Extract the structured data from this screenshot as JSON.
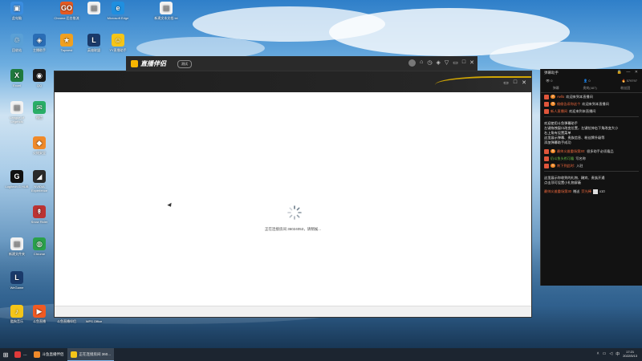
{
  "desktop": {
    "icons": [
      {
        "label": "此电脑",
        "color": "#3a8de0",
        "glyph": "▣"
      },
      {
        "label": "Chrome 后台推流",
        "color": "#e45a23",
        "glyph": "GO"
      },
      {
        "label": "",
        "color": "#f2f2f2",
        "glyph": "▤"
      },
      {
        "label": "Microsoft Edge",
        "color": "#1f8fe0",
        "glyph": "e"
      },
      {
        "label": "新建文本文档 txt",
        "color": "#f2f2f2",
        "glyph": "▤"
      },
      {
        "label": "回收站",
        "color": "#5aa0d6",
        "glyph": "♲"
      },
      {
        "label": "主播助手",
        "color": "#2a6db5",
        "glyph": "◈"
      },
      {
        "label": "Tapwest",
        "color": "#f0a020",
        "glyph": "★"
      },
      {
        "label": "英雄联盟",
        "color": "#1a3a6a",
        "glyph": "L"
      },
      {
        "label": "YY直播助手",
        "color": "#f5c518",
        "glyph": "☺"
      },
      {
        "label": "Excel",
        "color": "#1f7a3e",
        "glyph": "X"
      },
      {
        "label": "QQ",
        "color": "#1a1a1a",
        "glyph": "◉"
      },
      {
        "label": "League of Legends",
        "color": "#f2f2f2",
        "glyph": "▤"
      },
      {
        "label": "微信",
        "color": "#2aae67",
        "glyph": "✉"
      },
      {
        "label": "火绒安全",
        "color": "#f08a2a",
        "glyph": "◆"
      },
      {
        "label": "Logitech G HUB",
        "color": "#111",
        "glyph": "G"
      },
      {
        "label": "NVIDIA Experience",
        "color": "#2a2a2a",
        "glyph": "◢"
      },
      {
        "label": "Snow Rider",
        "color": "#b33",
        "glyph": "↟"
      },
      {
        "label": "新建文件夹",
        "color": "#f2f2f2",
        "glyph": "▤"
      },
      {
        "label": "Chrome",
        "color": "#2aa04a",
        "glyph": "◍"
      },
      {
        "label": "WeGame",
        "color": "#1a3a6a",
        "glyph": "L"
      },
      {
        "label": "酷狗音乐",
        "color": "#f5c518",
        "glyph": "♪"
      },
      {
        "label": "斗鱼直播",
        "color": "#f25a22",
        "glyph": "▶"
      },
      {
        "label": "斗鱼直播伴侣",
        "color": "#f08a2a",
        "glyph": "◆"
      },
      {
        "label": "WPS Office",
        "color": "#c33",
        "glyph": "W"
      }
    ]
  },
  "back_window": {
    "title": "直播伴侣",
    "version_badge": "测试",
    "controls": [
      "◐",
      "⌂",
      "◷",
      "◈",
      "▽",
      "▭",
      "□",
      "✕"
    ]
  },
  "main_window": {
    "controls": [
      "▭",
      "□",
      "✕"
    ],
    "loading_text": "正在连接房间 36024053，请稍候..."
  },
  "chat": {
    "title": "弹幕助手",
    "title_controls": "🔒 — ✕",
    "stats": {
      "left": "👁 0",
      "middle": "👤 0",
      "right": "🔥 579797"
    },
    "tabs": [
      "弹幕",
      "贵宾(487)",
      "粉丝团"
    ],
    "messages": [
      {
        "badge": "2",
        "user": "Aello",
        "text": "欢迎来到本直播间",
        "green": false
      },
      {
        "badge": "3",
        "user": "偷偷告诉你这个",
        "text": "欢迎来到本直播间",
        "green": false
      },
      {
        "badge": "",
        "user": "新人直播间",
        "text": "欢迎来到本直播间",
        "green": false
      }
    ],
    "system_lines": [
      "欢迎使用斗鱼弹幕助手",
      "左键拖拽窗口改变位置，左键拉伸右下角改变大小",
      "右上角有设置菜单",
      "这里展示弹幕、贵族信息、粉丝牌升级等",
      "添加弹幕助手成功"
    ],
    "messages2": [
      {
        "badge": "5",
        "user": "最帅义维重场第30:",
        "text": "很多助手必须看品",
        "green": false
      },
      {
        "badge": "",
        "user": "仍斗鱼头衔可看",
        "text": "写名称",
        "green": true
      },
      {
        "badge": "1",
        "user": "刺下到此时:",
        "text": "入驻",
        "green": false
      }
    ],
    "gift_lines": [
      "这里展示你收到的礼物、酬宾、贵族开通",
      "点击顶可设置小礼物屏蔽"
    ],
    "gift": {
      "user": "最帅义维重场第30",
      "action": "赠送",
      "item": "荧光棒",
      "count": "x10"
    }
  },
  "taskbar": {
    "start_glyph": "⊞",
    "tasks": [
      {
        "label": "---",
        "color": "#e03a3a",
        "active": false
      },
      {
        "label": "斗鱼直播伴侣",
        "color": "#f08a2a",
        "active": false
      },
      {
        "label": "正在连接房间 360...",
        "color": "#f5c518",
        "active": true
      }
    ],
    "time": "17:21",
    "date": "2022/5/13"
  }
}
